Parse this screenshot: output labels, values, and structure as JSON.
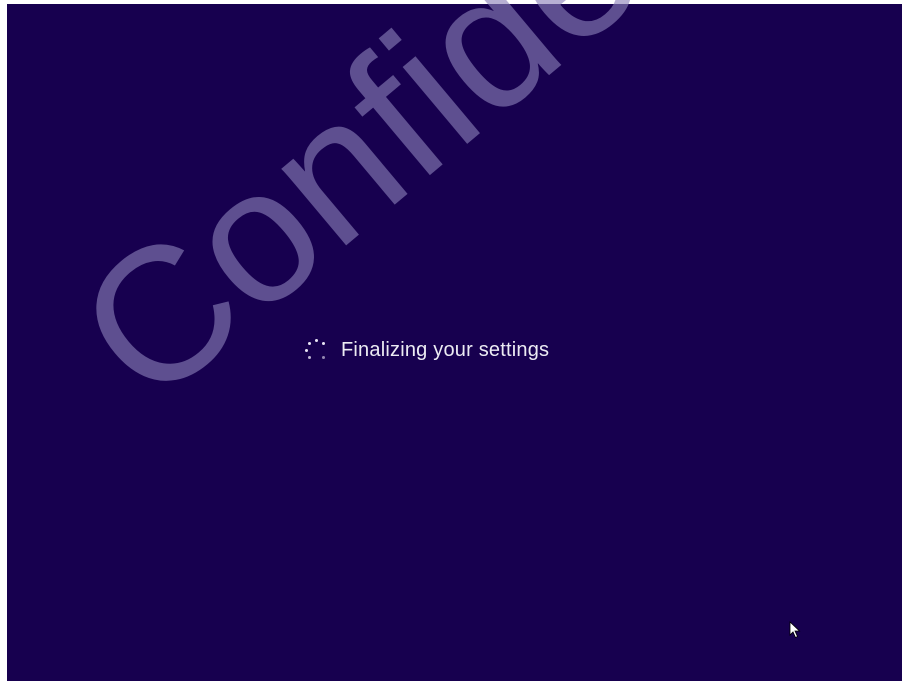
{
  "screen": {
    "background_color": "#17004f",
    "status_text": "Finalizing your settings",
    "spinner_icon": "loading-spinner-icon",
    "cursor_icon": "mouse-pointer-icon"
  },
  "watermark": {
    "text": "Confidential",
    "color": "#8a80b8"
  }
}
